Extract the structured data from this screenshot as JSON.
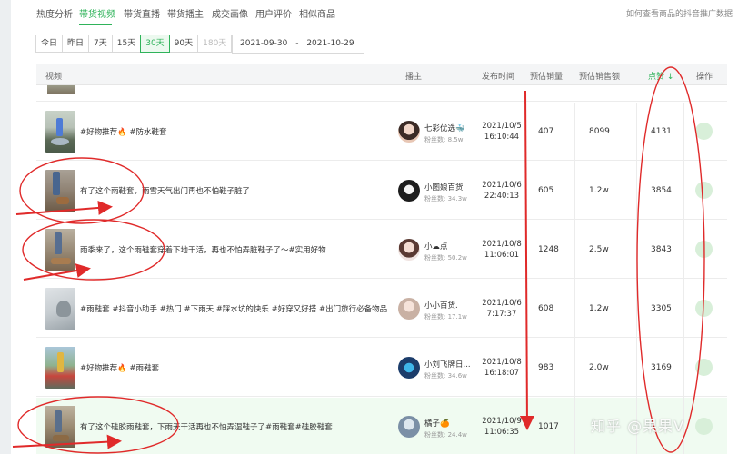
{
  "tabs": [
    {
      "label": "热度分析"
    },
    {
      "label": "带货视频",
      "active": true
    },
    {
      "label": "带货直播"
    },
    {
      "label": "带货播主"
    },
    {
      "label": "成交画像"
    },
    {
      "label": "用户评价"
    },
    {
      "label": "相似商品"
    }
  ],
  "help_link": "如何查看商品的抖音推广数据",
  "range_buttons": [
    {
      "label": "今日"
    },
    {
      "label": "昨日"
    },
    {
      "label": "7天"
    },
    {
      "label": "15天"
    },
    {
      "label": "30天",
      "active": true
    },
    {
      "label": "90天"
    },
    {
      "label": "180天",
      "disabled": true
    }
  ],
  "date_range": {
    "start": "2021-09-30",
    "separator": "-",
    "end": "2021-10-29"
  },
  "table": {
    "headers": {
      "video": "视频",
      "streamer": "播主",
      "publish_time": "发布时间",
      "est_sales": "预估销量",
      "est_amount": "预估销售额",
      "likes": "点赞 ↓",
      "action": "操作"
    },
    "rows": [
      {
        "title": "#好物推荐🔥 #防水鞋套",
        "streamer": "七彩优选🐳",
        "fans": "粉丝数: 8.5w",
        "date": "2021/10/5",
        "time": "16:10:44",
        "sales": "407",
        "amount": "8099",
        "likes": "4131"
      },
      {
        "title": "有了这个雨鞋套，雨雪天气出门再也不怕鞋子脏了",
        "streamer": "小图娘百货",
        "fans": "粉丝数: 34.3w",
        "date": "2021/10/6",
        "time": "22:40:13",
        "sales": "605",
        "amount": "1.2w",
        "likes": "3854"
      },
      {
        "title": "雨季来了，这个雨鞋套穿着下地干活，再也不怕弄脏鞋子了～#实用好物",
        "streamer": "小☁点",
        "fans": "粉丝数: 50.2w",
        "date": "2021/10/8",
        "time": "11:06:01",
        "sales": "1248",
        "amount": "2.5w",
        "likes": "3843"
      },
      {
        "title": "#雨鞋套 #抖音小助手 #热门 #下雨天 #踩水坑的快乐 #好穿又好搭 #出门旅行必备物品",
        "streamer": "小小百货.",
        "fans": "粉丝数: 17.1w",
        "date": "2021/10/6",
        "time": "7:17:37",
        "sales": "608",
        "amount": "1.2w",
        "likes": "3305"
      },
      {
        "title": "#好物推荐🔥 #雨鞋套",
        "streamer": "小刘飞牌日...",
        "fans": "粉丝数: 34.6w",
        "date": "2021/10/8",
        "time": "16:18:07",
        "sales": "983",
        "amount": "2.0w",
        "likes": "3169"
      },
      {
        "title": "有了这个硅胶雨鞋套，下雨天干活再也不怕弄湿鞋子了#雨鞋套#硅胶鞋套",
        "streamer": "橘子🍊",
        "fans": "粉丝数: 24.4w",
        "date": "2021/10/9",
        "time": "11:06:35",
        "sales": "1017",
        "amount": "",
        "likes": "",
        "highlight": true
      }
    ]
  },
  "watermark": "知乎 @果果V",
  "colors": {
    "accent": "#2fb35a",
    "annotation": "#e02a2a",
    "highlight_row": "#f0fbf1"
  }
}
